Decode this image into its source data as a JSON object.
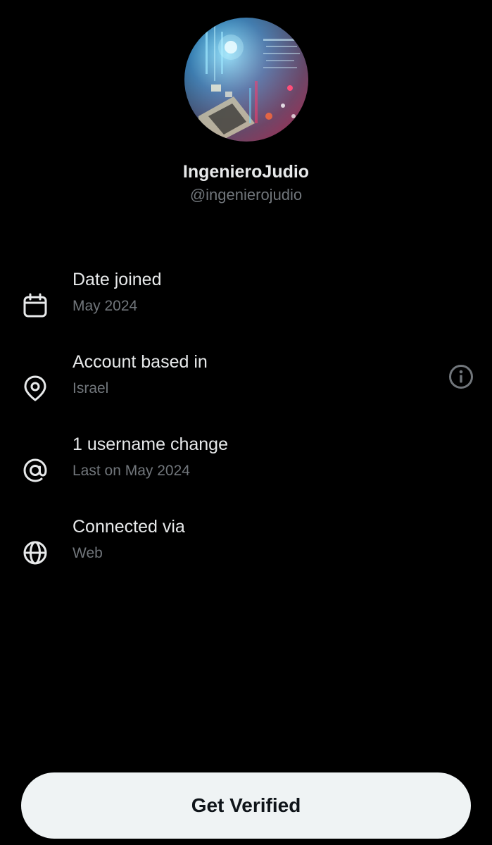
{
  "profile": {
    "display_name": "IngenieroJudio",
    "handle": "@ingenierojudio"
  },
  "rows": [
    {
      "icon": "calendar-icon",
      "title": "Date joined",
      "subtitle": "May 2024"
    },
    {
      "icon": "location-pin-icon",
      "title": "Account based in",
      "subtitle": "Israel"
    },
    {
      "icon": "at-sign-icon",
      "title": "1 username change",
      "subtitle": "Last on May 2024"
    },
    {
      "icon": "globe-icon",
      "title": "Connected via",
      "subtitle": "Web"
    }
  ],
  "actions": {
    "get_verified_label": "Get Verified"
  },
  "colors": {
    "background": "#000000",
    "primary_text": "#e7e9ea",
    "secondary_text": "#71767b",
    "button_bg": "#eff3f4",
    "button_text": "#0f1419"
  }
}
